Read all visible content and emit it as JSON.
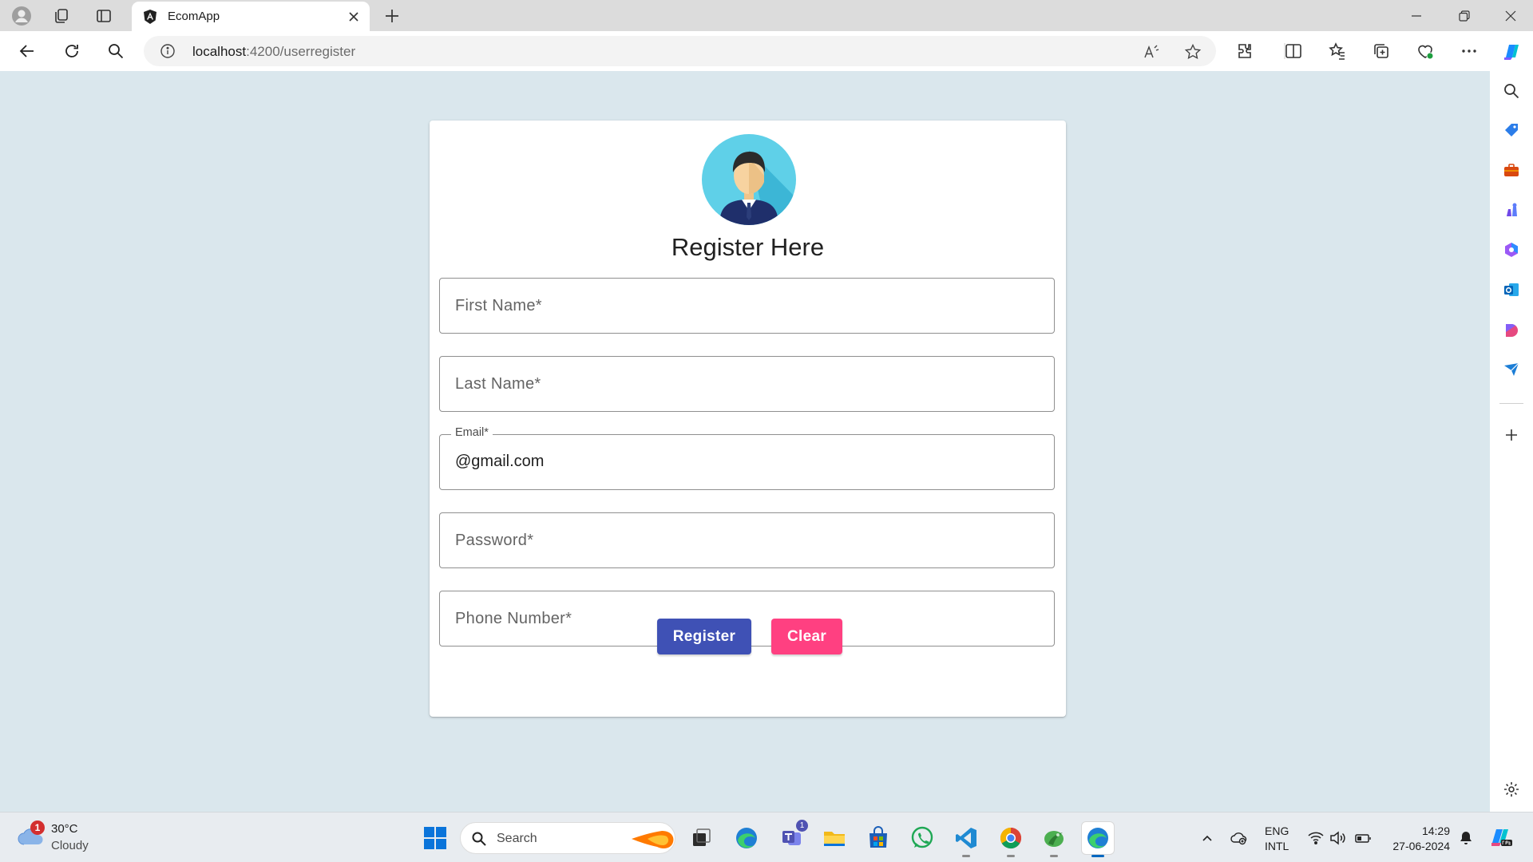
{
  "browser": {
    "tab_title": "EcomApp",
    "url_host": "localhost",
    "url_rest": ":4200/userregister"
  },
  "page": {
    "title": "Register Here",
    "fields": {
      "first_name": {
        "placeholder": "First Name*"
      },
      "last_name": {
        "placeholder": "Last Name*"
      },
      "email": {
        "label": "Email*",
        "value": "@gmail.com"
      },
      "password": {
        "placeholder": "Password*"
      },
      "phone": {
        "placeholder": "Phone Number*"
      }
    },
    "buttons": {
      "register": "Register",
      "clear": "Clear"
    },
    "colors": {
      "primary": "#3f51b5",
      "accent": "#ff4081",
      "background": "#dae7ed"
    }
  },
  "taskbar": {
    "weather_badge": "1",
    "temperature": "30°C",
    "condition": "Cloudy",
    "search_label": "Search",
    "teams_badge": "1",
    "lang_line1": "ENG",
    "lang_line2": "INTL",
    "time": "14:29",
    "date": "27-06-2024"
  }
}
